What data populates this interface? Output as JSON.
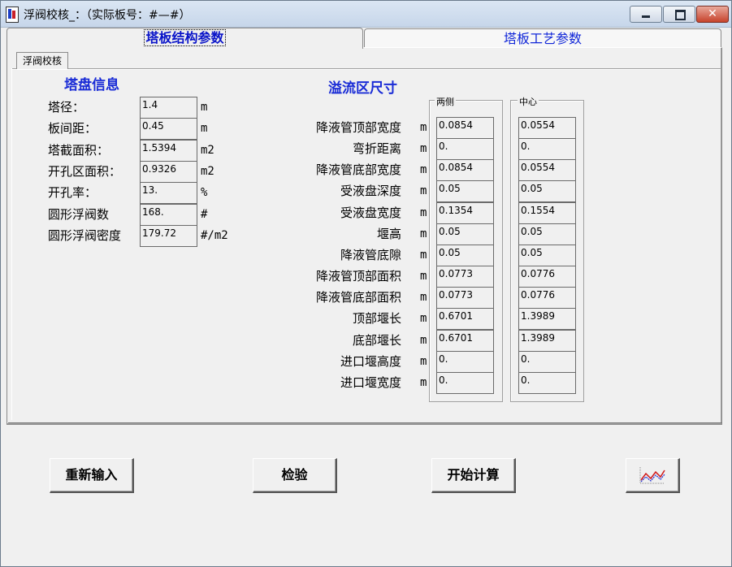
{
  "window": {
    "title": "浮阀校核_：（实际板号：#—#）",
    "controls": [
      "minimize",
      "maximize",
      "close"
    ]
  },
  "tabs": [
    {
      "label": "塔板结构参数",
      "active": true
    },
    {
      "label": "塔板工艺参数",
      "active": false
    }
  ],
  "subtab": {
    "label": "浮阀校核"
  },
  "tower_info": {
    "heading": "塔盘信息",
    "rows": [
      {
        "label": "塔径：",
        "value": "1.4",
        "unit": "m"
      },
      {
        "label": "板间距：",
        "value": "0.45",
        "unit": "m"
      },
      {
        "label": "塔截面积：",
        "value": "1.5394",
        "unit": "m2"
      },
      {
        "label": "开孔区面积：",
        "value": "0.9326",
        "unit": "m2"
      },
      {
        "label": "开孔率：",
        "value": "13.",
        "unit": "%"
      },
      {
        "label": "圆形浮阀数",
        "value": "168.",
        "unit": "#"
      },
      {
        "label": "圆形浮阀密度",
        "value": "179.72",
        "unit": "#/m2"
      }
    ]
  },
  "downcomer": {
    "heading": "溢流区尺寸",
    "group_side": "两侧",
    "group_center": "中心",
    "rows": [
      {
        "label": "降液管顶部宽度",
        "unit": "m",
        "side": "0.0854",
        "center": "0.0554"
      },
      {
        "label": "弯折距离",
        "unit": "m",
        "side": "0.",
        "center": "0."
      },
      {
        "label": "降液管底部宽度",
        "unit": "m",
        "side": "0.0854",
        "center": "0.0554"
      },
      {
        "label": "受液盘深度",
        "unit": "m",
        "side": "0.05",
        "center": "0.05"
      },
      {
        "label": "受液盘宽度",
        "unit": "m",
        "side": "0.1354",
        "center": "0.1554"
      },
      {
        "label": "堰高",
        "unit": "m",
        "side": "0.05",
        "center": "0.05"
      },
      {
        "label": "降液管底隙",
        "unit": "m",
        "side": "0.05",
        "center": "0.05"
      },
      {
        "label": "降液管顶部面积",
        "unit": "m",
        "side": "0.0773",
        "center": "0.0776"
      },
      {
        "label": "降液管底部面积",
        "unit": "m",
        "side": "0.0773",
        "center": "0.0776"
      },
      {
        "label": "顶部堰长",
        "unit": "m",
        "side": "0.6701",
        "center": "1.3989"
      },
      {
        "label": "底部堰长",
        "unit": "m",
        "side": "0.6701",
        "center": "1.3989"
      },
      {
        "label": "进口堰高度",
        "unit": "m",
        "side": "0.",
        "center": "0."
      },
      {
        "label": "进口堰宽度",
        "unit": "m",
        "side": "0.",
        "center": "0."
      }
    ]
  },
  "buttons": {
    "reset": "重新输入",
    "check": "检验",
    "calculate": "开始计算",
    "chart_icon": "chart-icon"
  }
}
